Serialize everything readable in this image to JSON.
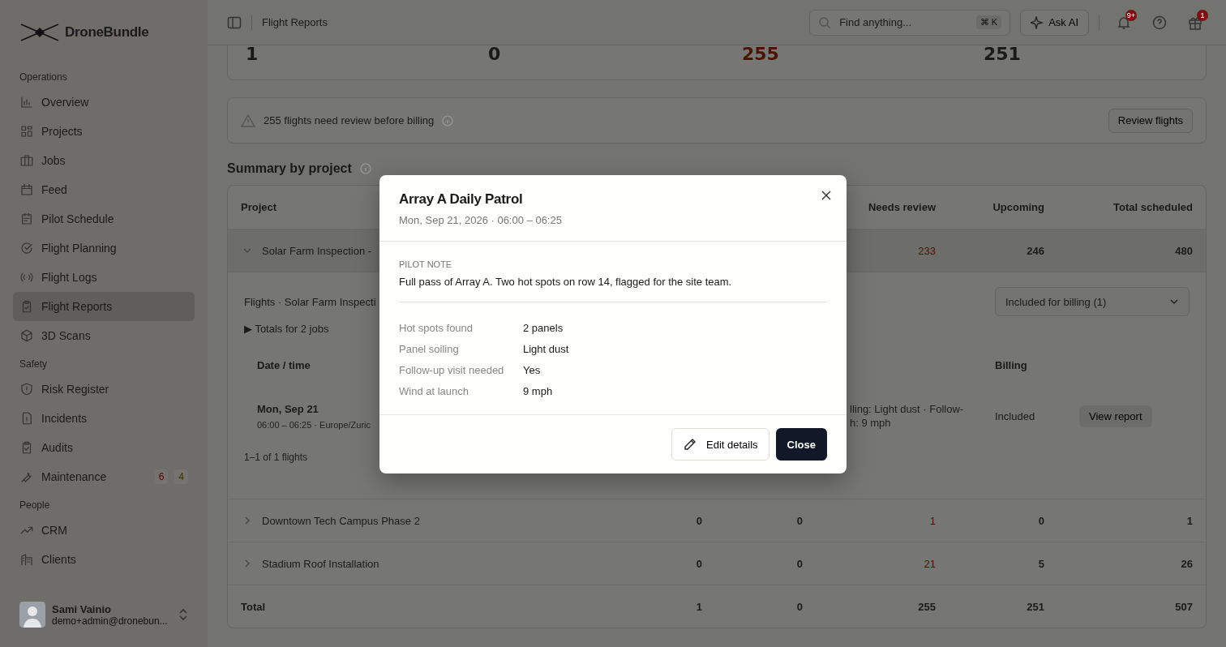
{
  "app": {
    "name": "DroneBundle"
  },
  "sidebar": {
    "sections": [
      {
        "title": "Operations",
        "items": [
          {
            "label": "Overview",
            "selected": false
          },
          {
            "label": "Projects",
            "selected": false
          },
          {
            "label": "Jobs",
            "selected": false
          },
          {
            "label": "Feed",
            "selected": false
          },
          {
            "label": "Pilot Schedule",
            "selected": false
          },
          {
            "label": "Flight Planning",
            "selected": false
          },
          {
            "label": "Flight Logs",
            "selected": false
          },
          {
            "label": "Flight Reports",
            "selected": true
          },
          {
            "label": "3D Scans",
            "selected": false
          }
        ]
      },
      {
        "title": "Safety",
        "items": [
          {
            "label": "Risk Register",
            "selected": false
          },
          {
            "label": "Incidents",
            "selected": false
          },
          {
            "label": "Audits",
            "selected": false
          },
          {
            "label": "Maintenance",
            "selected": false,
            "badges": [
              {
                "text": "6",
                "color": "#5c0000"
              },
              {
                "text": "4",
                "color": "#3d3000"
              }
            ]
          }
        ]
      },
      {
        "title": "People",
        "items": [
          {
            "label": "CRM",
            "selected": false
          },
          {
            "label": "Clients",
            "selected": false
          }
        ]
      }
    ],
    "user": {
      "name": "Sami Vainio",
      "email": "demo+admin@dronebun..."
    }
  },
  "header": {
    "breadcrumb": "Flight Reports",
    "search": {
      "placeholder": "Find anything...",
      "shortcut": "⌘ K"
    },
    "ask_ai": "Ask AI",
    "notification_badge": "9+",
    "gift_badge": "1"
  },
  "stats": [
    {
      "value": "1",
      "highlight": false
    },
    {
      "value": "0",
      "highlight": false
    },
    {
      "value": "255",
      "highlight": true
    },
    {
      "value": "251",
      "highlight": false
    }
  ],
  "review_banner": {
    "text": "255 flights need review before billing",
    "button": "Review flights"
  },
  "summary": {
    "title": "Summary by project",
    "columns": {
      "project": "Project",
      "needs_review": "Needs review",
      "upcoming": "Upcoming",
      "total_scheduled": "Total scheduled"
    },
    "rows": [
      {
        "project": "Solar Farm Inspection -",
        "expanded": true,
        "needs_review": "233",
        "upcoming": "246",
        "total_scheduled": "480",
        "highlight": true,
        "detail": {
          "title": "Flights · Solar Farm Inspecti",
          "filter": "Included for billing (1)",
          "totals_toggle": "▶ Totals for 2 jobs",
          "columns": {
            "date_time": "Date / time",
            "billing": "Billing"
          },
          "flights": [
            {
              "date": "Mon, Sep 21",
              "time": "06:00 – 06:25 · Europe/Zuric",
              "notes": [
                "lling: Light dust · Follow-",
                "h: 9 mph"
              ],
              "billing": "Included",
              "action": "View report"
            }
          ],
          "pagination": "1–1 of 1 flights"
        }
      },
      {
        "project": "Downtown Tech Campus Phase 2",
        "expanded": false,
        "column_2": "0",
        "column_3": "0",
        "needs_review": "1",
        "upcoming": "0",
        "total_scheduled": "1",
        "highlight": true
      },
      {
        "project": "Stadium Roof Installation",
        "expanded": false,
        "column_2": "0",
        "column_3": "0",
        "needs_review": "21",
        "upcoming": "5",
        "total_scheduled": "26",
        "highlight": true
      }
    ],
    "total": {
      "label": "Total",
      "column_2": "1",
      "column_3": "0",
      "needs_review": "255",
      "upcoming": "251",
      "total_scheduled": "507"
    }
  },
  "dialog": {
    "title": "Array A Daily Patrol",
    "subtitle": "Mon, Sep 21, 2026 · 06:00 – 06:25",
    "note_label": "PILOT NOTE",
    "note": "Full pass of Array A. Two hot spots on row 14, flagged for the site team.",
    "fields": [
      {
        "label": "Hot spots found",
        "value": "2 panels"
      },
      {
        "label": "Panel soiling",
        "value": "Light dust"
      },
      {
        "label": "Follow-up visit needed",
        "value": "Yes"
      },
      {
        "label": "Wind at launch",
        "value": "9 mph"
      }
    ],
    "buttons": [
      {
        "label": "Edit details",
        "kind": "secondary"
      },
      {
        "label": "Close",
        "kind": "primary"
      }
    ]
  }
}
